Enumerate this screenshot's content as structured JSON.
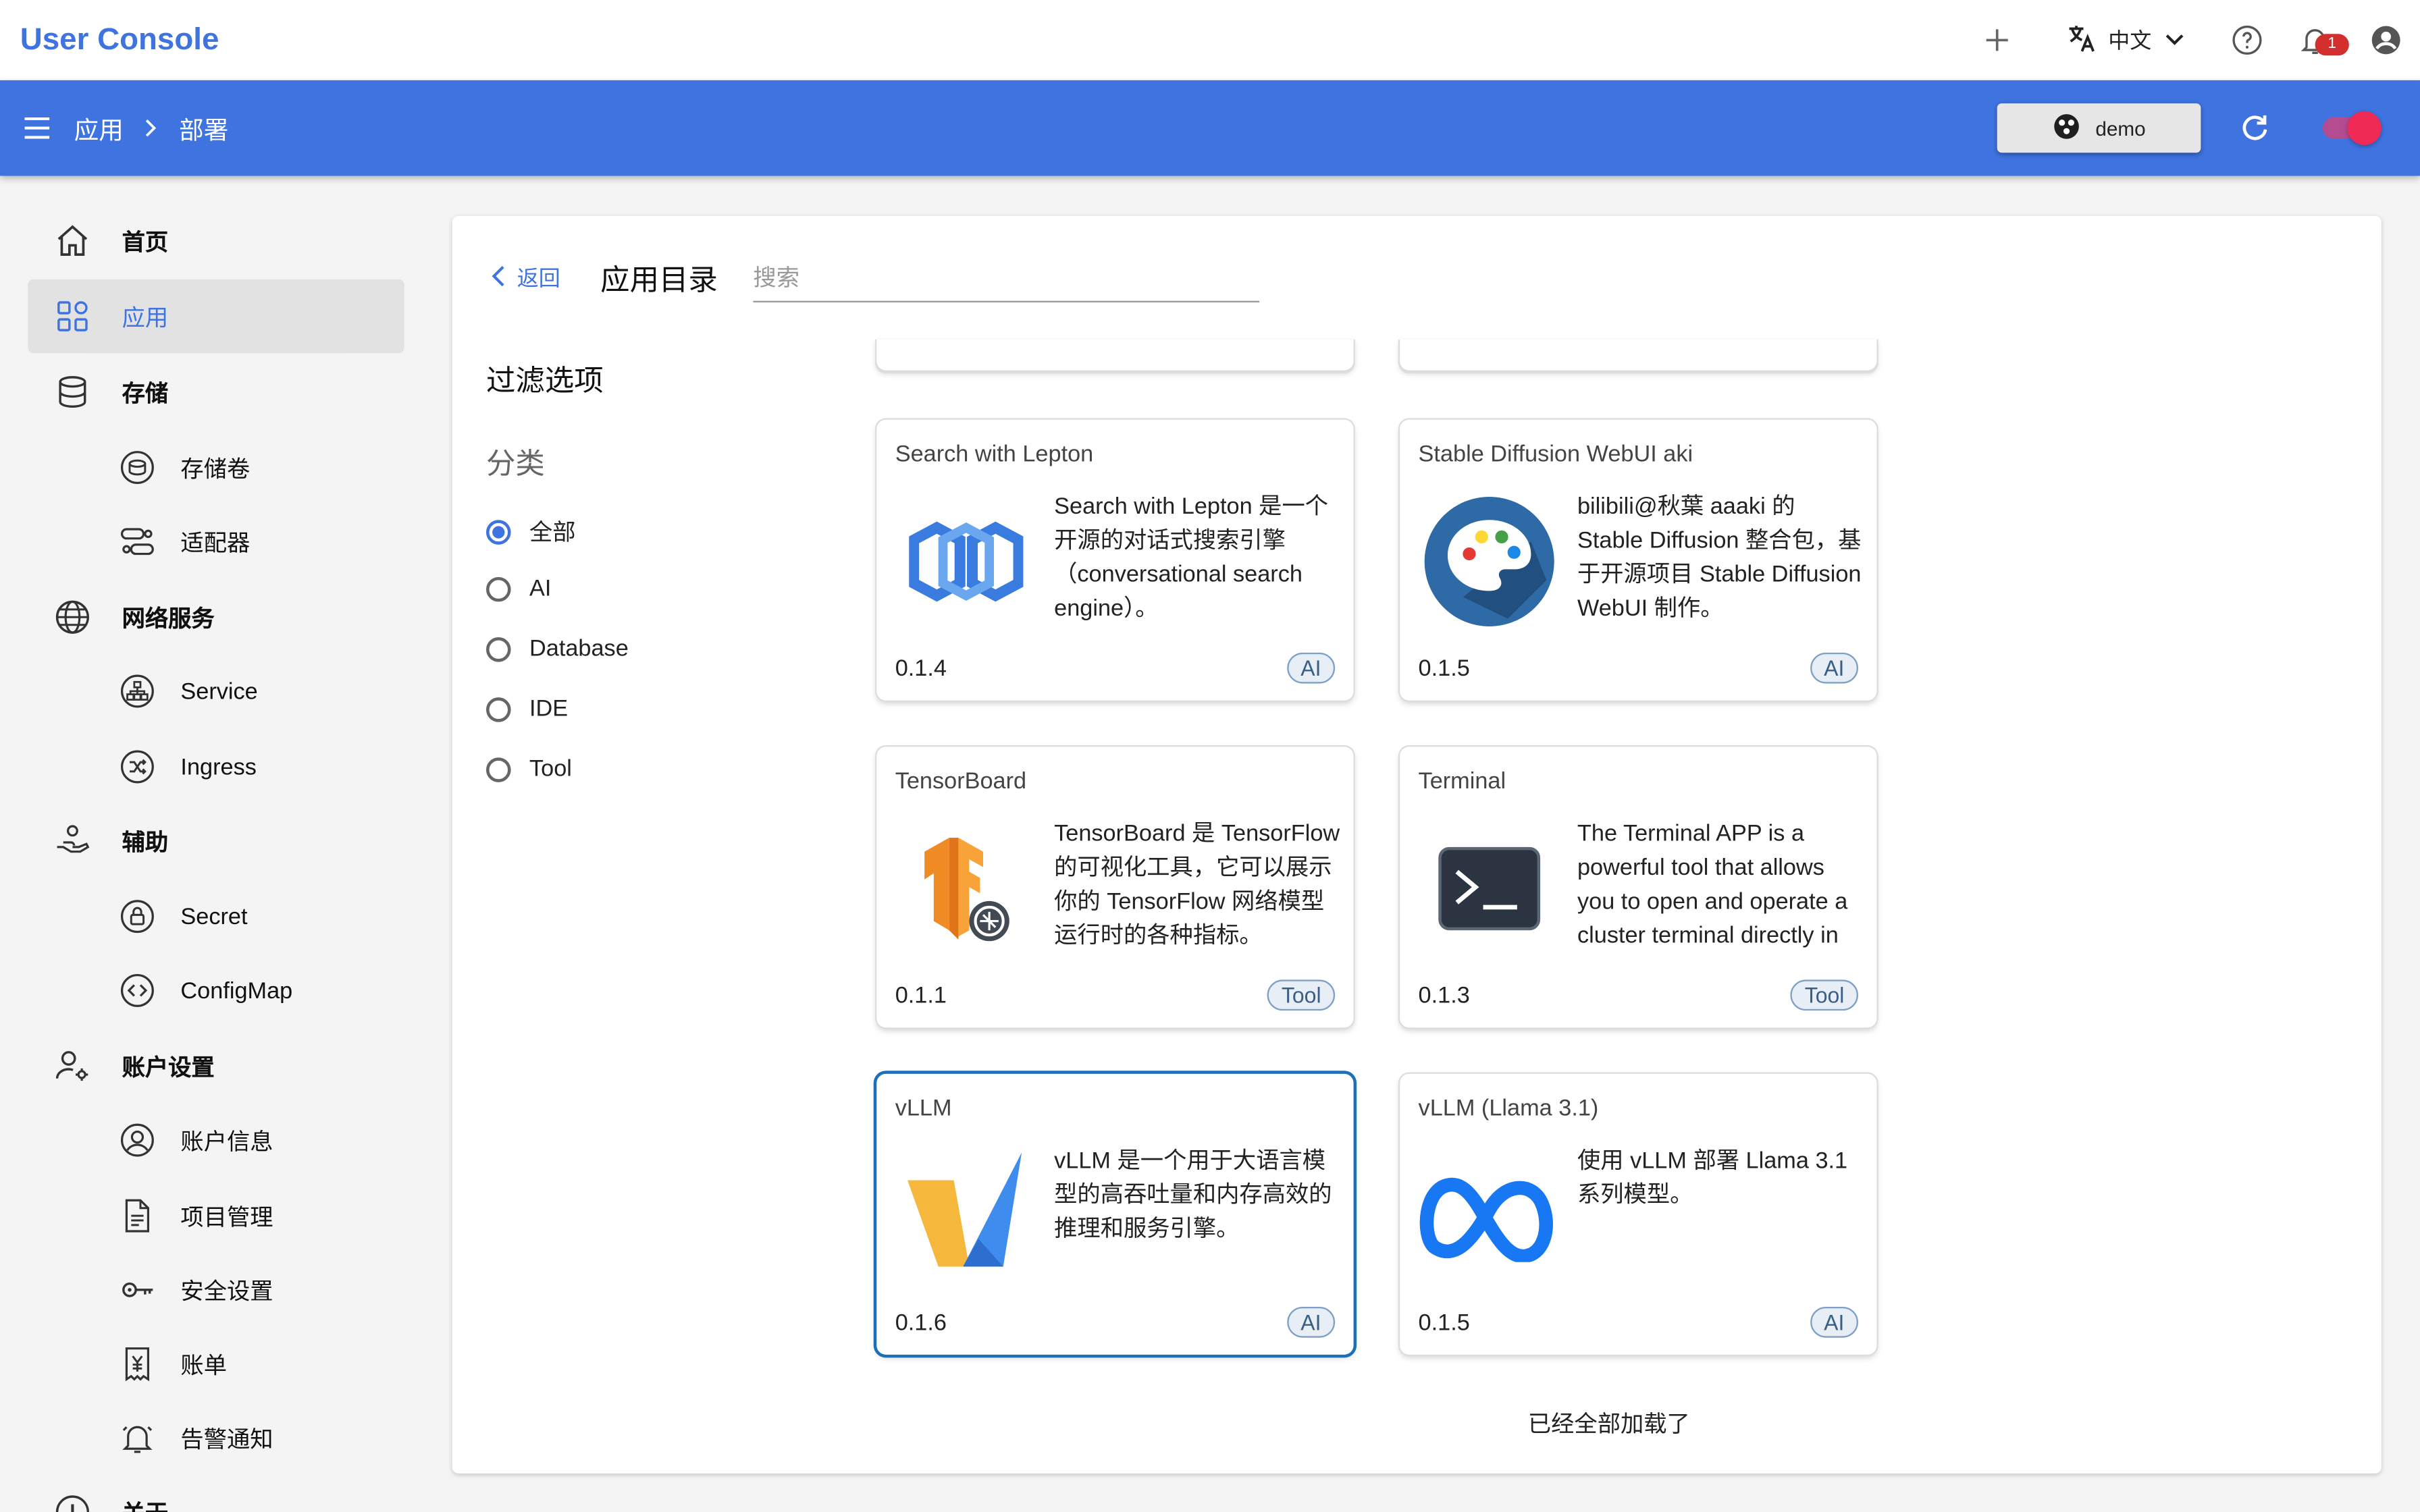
{
  "app": {
    "brand": "User Console"
  },
  "topbar": {
    "language": "中文",
    "notification_count": "1"
  },
  "breadcrumb": {
    "items": [
      "应用",
      "部署"
    ]
  },
  "namespace": {
    "selected": "demo"
  },
  "sidebar": {
    "items": [
      {
        "label": "首页",
        "icon": "home-icon"
      },
      {
        "label": "应用",
        "icon": "apps-icon",
        "active": true
      },
      {
        "label": "存储",
        "icon": "database-icon"
      },
      {
        "label": "存储卷",
        "icon": "volume-icon",
        "sub": true
      },
      {
        "label": "适配器",
        "icon": "adapter-icon",
        "sub": true
      },
      {
        "label": "网络服务",
        "icon": "globe-icon"
      },
      {
        "label": "Service",
        "icon": "service-icon",
        "sub": true
      },
      {
        "label": "Ingress",
        "icon": "ingress-icon",
        "sub": true
      },
      {
        "label": "辅助",
        "icon": "helper-hand-icon"
      },
      {
        "label": "Secret",
        "icon": "lock-icon",
        "sub": true
      },
      {
        "label": "ConfigMap",
        "icon": "code-icon",
        "sub": true
      },
      {
        "label": "账户设置",
        "icon": "account-settings-icon"
      },
      {
        "label": "账户信息",
        "icon": "user-circle-icon",
        "sub": true
      },
      {
        "label": "项目管理",
        "icon": "document-icon",
        "sub": true
      },
      {
        "label": "安全设置",
        "icon": "key-icon",
        "sub": true
      },
      {
        "label": "账单",
        "icon": "bill-icon",
        "sub": true
      },
      {
        "label": "告警通知",
        "icon": "bell-icon",
        "sub": true
      },
      {
        "label": "关于",
        "icon": "info-icon"
      }
    ]
  },
  "catalog": {
    "back_label": "返回",
    "title": "应用目录",
    "search_placeholder": "搜索",
    "filter_title": "过滤选项",
    "category_label": "分类",
    "categories": [
      "全部",
      "AI",
      "Database",
      "IDE",
      "Tool"
    ],
    "selected_category": "全部",
    "end_message": "已经全部加载了"
  },
  "apps": [
    {
      "title": "Search with Lepton",
      "description": "Search with Lepton 是一个开源的对话式搜索引擎（conversational search engine）。",
      "version": "0.1.4",
      "tag": "AI",
      "logo": "lepton-logo"
    },
    {
      "title": "Stable Diffusion WebUI aki",
      "description": "bilibili@秋葉 aaaki 的 Stable Diffusion 整合包，基于开源项目 Stable Diffusion WebUI 制作。",
      "version": "0.1.5",
      "tag": "AI",
      "logo": "palette-logo"
    },
    {
      "title": "TensorBoard",
      "description": "TensorBoard 是 TensorFlow 的可视化工具，它可以展示你的 TensorFlow 网络模型运行时的各种指标。",
      "version": "0.1.1",
      "tag": "Tool",
      "logo": "tensorflow-logo"
    },
    {
      "title": "Terminal",
      "description": "The Terminal APP is a powerful tool that allows you to open and operate a cluster terminal directly in",
      "version": "0.1.3",
      "tag": "Tool",
      "logo": "terminal-logo"
    },
    {
      "title": "vLLM",
      "description": "vLLM 是一个用于大语言模型的高吞吐量和内存高效的推理和服务引擎。",
      "version": "0.1.6",
      "tag": "AI",
      "logo": "vllm-logo",
      "selected": true
    },
    {
      "title": "vLLM (Llama 3.1)",
      "description": "使用 vLLM 部署 Llama 3.1 系列模型。",
      "version": "0.1.5",
      "tag": "AI",
      "logo": "meta-logo"
    }
  ],
  "colors": {
    "brand": "#3f73e0",
    "selected_border": "#1d6fb8",
    "toggle": "#ef2a55"
  }
}
